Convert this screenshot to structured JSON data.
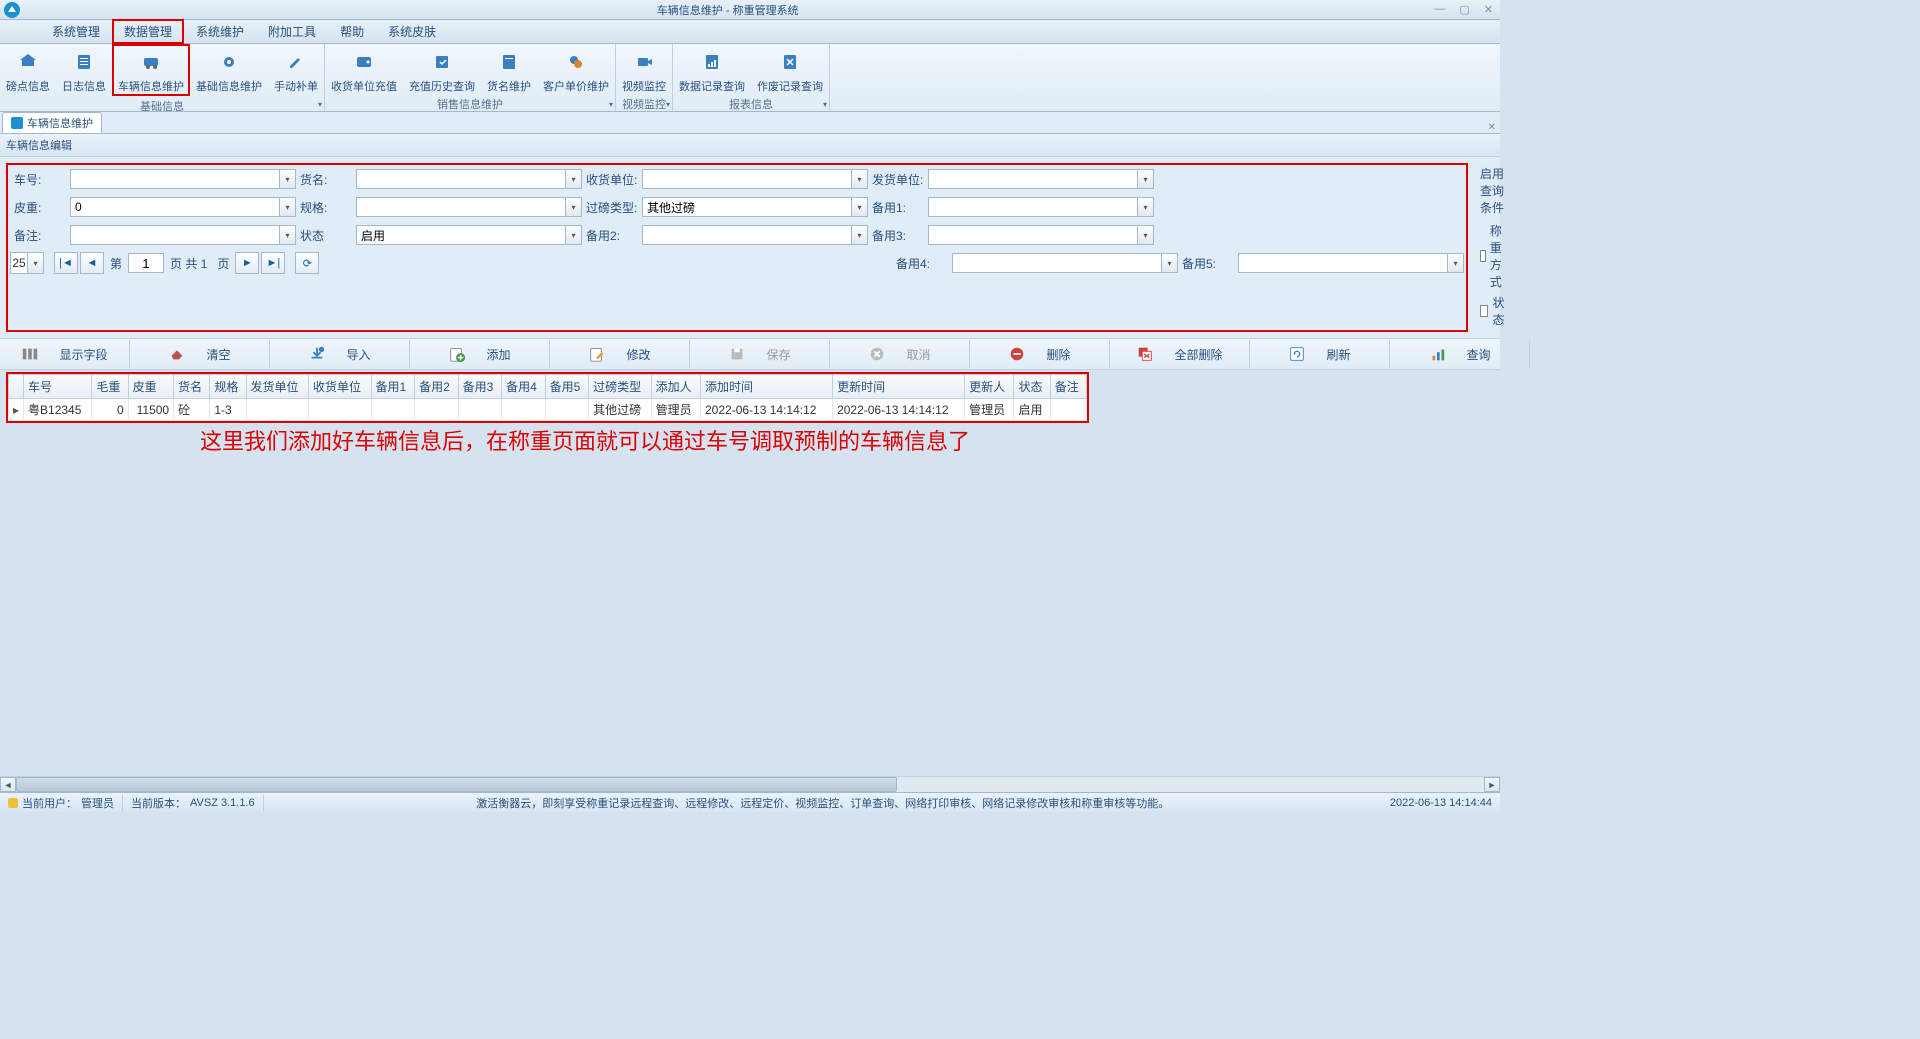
{
  "window": {
    "title": "车辆信息维护 - 称重管理系统"
  },
  "menu": {
    "items": [
      "系统管理",
      "数据管理",
      "系统维护",
      "附加工具",
      "帮助",
      "系统皮肤"
    ],
    "highlighted": 1
  },
  "ribbon": {
    "groups": [
      {
        "label": "基础信息",
        "items": [
          {
            "label": "磅点信息",
            "icon": "home"
          },
          {
            "label": "日志信息",
            "icon": "log"
          },
          {
            "label": "车辆信息维护",
            "icon": "vehicle",
            "highlighted": true
          },
          {
            "label": "基础信息维护",
            "icon": "gear"
          },
          {
            "label": "手动补单",
            "icon": "pencil"
          }
        ]
      },
      {
        "label": "销售信息维护",
        "items": [
          {
            "label": "收货单位充值",
            "icon": "wallet"
          },
          {
            "label": "充值历史查询",
            "icon": "history"
          },
          {
            "label": "货名维护",
            "icon": "goods"
          },
          {
            "label": "客户单价维护",
            "icon": "price"
          }
        ]
      },
      {
        "label": "视频监控",
        "items": [
          {
            "label": "视频监控",
            "icon": "camera"
          }
        ]
      },
      {
        "label": "报表信息",
        "items": [
          {
            "label": "数据记录查询",
            "icon": "report"
          },
          {
            "label": "作废记录查询",
            "icon": "void"
          }
        ]
      }
    ]
  },
  "tab": {
    "label": "车辆信息维护"
  },
  "panel": {
    "title": "车辆信息编辑"
  },
  "form": {
    "rows": [
      [
        {
          "label": "车号:",
          "value": ""
        },
        {
          "label": "货名:",
          "value": ""
        },
        {
          "label": "收货单位:",
          "value": ""
        },
        {
          "label": "发货单位:",
          "value": ""
        }
      ],
      [
        {
          "label": "皮重:",
          "value": "0"
        },
        {
          "label": "规格:",
          "value": ""
        },
        {
          "label": "过磅类型:",
          "value": "其他过磅"
        },
        {
          "label": "备用1:",
          "value": ""
        }
      ],
      [
        {
          "label": "备注:",
          "value": ""
        },
        {
          "label": "状态",
          "value": "启用"
        },
        {
          "label": "备用2:",
          "value": ""
        },
        {
          "label": "备用3:",
          "value": ""
        }
      ],
      [
        null,
        null,
        {
          "label": "备用4:",
          "value": ""
        },
        {
          "label": "备用5:",
          "value": ""
        }
      ]
    ],
    "side": {
      "title": "启用查询条件",
      "checks": [
        "称重方式",
        "状态"
      ]
    }
  },
  "pagination": {
    "page_size": "25",
    "prefix": "第",
    "page": "1",
    "middle": "页  共 1",
    "suffix": "页"
  },
  "actions": [
    {
      "label": "显示字段",
      "icon": "columns"
    },
    {
      "label": "清空",
      "icon": "eraser"
    },
    {
      "label": "导入",
      "icon": "import"
    },
    {
      "label": "添加",
      "icon": "add"
    },
    {
      "label": "修改",
      "icon": "edit"
    },
    {
      "label": "保存",
      "icon": "save",
      "disabled": true
    },
    {
      "label": "取消",
      "icon": "cancel",
      "disabled": true
    },
    {
      "label": "删除",
      "icon": "delete"
    },
    {
      "label": "全部删除",
      "icon": "delete-all"
    },
    {
      "label": "刷新",
      "icon": "refresh"
    },
    {
      "label": "查询",
      "icon": "search"
    }
  ],
  "table": {
    "columns": [
      "车号",
      "毛重",
      "皮重",
      "货名",
      "规格",
      "发货单位",
      "收货单位",
      "备用1",
      "备用2",
      "备用3",
      "备用4",
      "备用5",
      "过磅类型",
      "添加人",
      "添加时间",
      "更新时间",
      "更新人",
      "状态",
      "备注"
    ],
    "rows": [
      {
        "车号": "粤B12345",
        "毛重": "0",
        "皮重": "11500",
        "货名": "砼",
        "规格": "1-3",
        "发货单位": "",
        "收货单位": "",
        "备用1": "",
        "备用2": "",
        "备用3": "",
        "备用4": "",
        "备用5": "",
        "过磅类型": "其他过磅",
        "添加人": "管理员",
        "添加时间": "2022-06-13 14:14:12",
        "更新时间": "2022-06-13 14:14:12",
        "更新人": "管理员",
        "状态": "启用",
        "备注": ""
      }
    ]
  },
  "annotation": "这里我们添加好车辆信息后，在称重页面就可以通过车号调取预制的车辆信息了",
  "status": {
    "user_label": "当前用户：",
    "user": "管理员",
    "version_label": "当前版本：",
    "version": "AVSZ 3.1.1.6",
    "center": "激活衡器云，即刻享受称重记录远程查询、远程修改、远程定价、视频监控、订单查询、网络打印审核、网络记录修改审核和称重审核等功能。",
    "time": "2022-06-13 14:14:44"
  }
}
